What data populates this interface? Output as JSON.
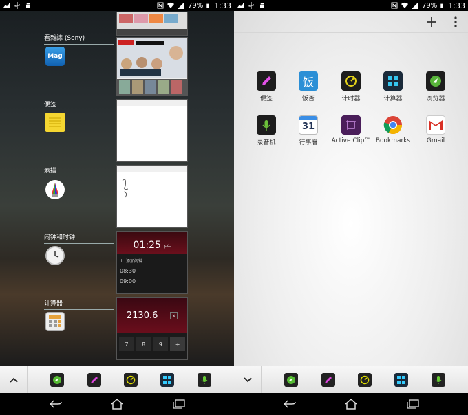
{
  "status": {
    "battery": "79%",
    "time": "1:33"
  },
  "left": {
    "recent_apps": [
      {
        "label": "看雜誌 (Sony)",
        "icon": "magv-icon"
      },
      {
        "label": "便签",
        "icon": "notes-icon"
      },
      {
        "label": "素描",
        "icon": "sketch-icon"
      },
      {
        "label": "闹钟和时钟",
        "icon": "clock-icon"
      },
      {
        "label": "计算器",
        "icon": "calculator-icon"
      }
    ],
    "magazine_icon_text": "Mag",
    "clock_thumb": {
      "time": "01:25",
      "ampm": "下午",
      "add_alarm": "添加闹钟",
      "alarms": [
        "08:30",
        "09:00"
      ]
    },
    "calc_thumb": {
      "display": "2130.6",
      "clear": "x",
      "keys": [
        "7",
        "8",
        "9",
        "÷"
      ]
    }
  },
  "small_apps": [
    "browser-icon",
    "notes-icon",
    "timer-icon",
    "calculator-icon",
    "recorder-icon"
  ],
  "right": {
    "apps": [
      {
        "label": "便签",
        "icon": "notes-icon"
      },
      {
        "label": "饭否",
        "icon": "fanfou-icon",
        "glyph": "饭"
      },
      {
        "label": "计时器",
        "icon": "timer-icon"
      },
      {
        "label": "计算器",
        "icon": "calculator-icon"
      },
      {
        "label": "浏览器",
        "icon": "browser-icon"
      },
      {
        "label": "录音机",
        "icon": "recorder-icon"
      },
      {
        "label": "行事曆",
        "icon": "calendar-icon",
        "glyph": "31"
      },
      {
        "label": "Active Clip™",
        "icon": "active-clip-icon"
      },
      {
        "label": "Bookmarks",
        "icon": "chrome-icon"
      },
      {
        "label": "Gmail",
        "icon": "gmail-icon"
      }
    ]
  }
}
